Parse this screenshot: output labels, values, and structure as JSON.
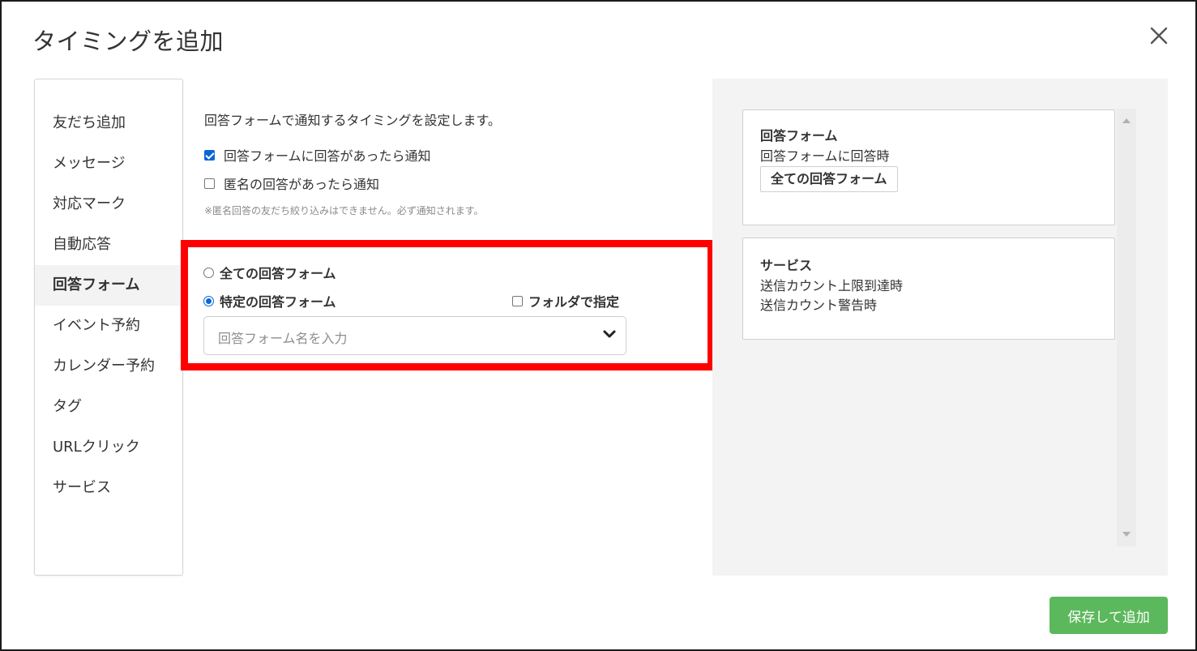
{
  "dialog": {
    "title": "タイミングを追加"
  },
  "sidebar": {
    "items": [
      {
        "label": "友だち追加"
      },
      {
        "label": "メッセージ"
      },
      {
        "label": "対応マーク"
      },
      {
        "label": "自動応答"
      },
      {
        "label": "回答フォーム",
        "active": true
      },
      {
        "label": "イベント予約"
      },
      {
        "label": "カレンダー予約"
      },
      {
        "label": "タグ"
      },
      {
        "label": "URLクリック"
      },
      {
        "label": "サービス"
      }
    ]
  },
  "main": {
    "description": "回答フォームで通知するタイミングを設定します。",
    "checkbox_answer": {
      "label": "回答フォームに回答があったら通知",
      "checked": true
    },
    "checkbox_anonymous": {
      "label": "匿名の回答があったら通知",
      "checked": false
    },
    "note": "※匿名回答の友だち絞り込みはできません。必ず通知されます。",
    "radio_all": {
      "label": "全ての回答フォーム",
      "selected": false
    },
    "radio_specific": {
      "label": "特定の回答フォーム",
      "selected": true
    },
    "folder_checkbox": {
      "label": "フォルダで指定",
      "checked": false
    },
    "form_select": {
      "placeholder": "回答フォーム名を入力"
    },
    "highlight_color": "#ff0000"
  },
  "preview": {
    "cards": [
      {
        "title": "回答フォーム",
        "lines": [
          "回答フォームに回答時"
        ],
        "tag": "全ての回答フォーム"
      },
      {
        "title": "サービス",
        "lines": [
          "送信カウント上限到達時",
          "送信カウント警告時"
        ]
      }
    ]
  },
  "footer": {
    "save_label": "保存して追加",
    "save_color": "#5cb85c"
  }
}
